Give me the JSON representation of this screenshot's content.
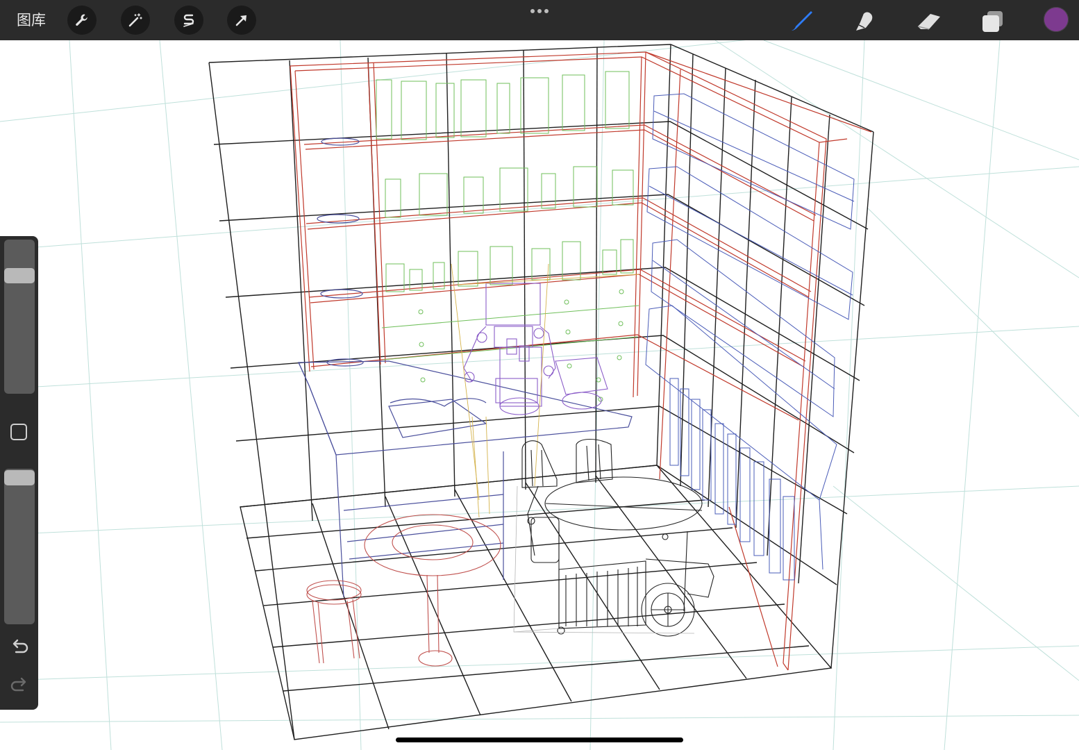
{
  "topbar": {
    "gallery_label": "图库",
    "tools_left": [
      {
        "name": "actions",
        "icon": "wrench-icon"
      },
      {
        "name": "adjustments",
        "icon": "magic-wand-icon"
      },
      {
        "name": "selection",
        "icon": "selection-s-icon"
      },
      {
        "name": "transform",
        "icon": "arrow-cursor-icon"
      }
    ],
    "more_icon": "ellipsis-icon",
    "tools_right": [
      {
        "name": "brush",
        "icon": "brush-icon",
        "active": true
      },
      {
        "name": "smudge",
        "icon": "smudge-finger-icon"
      },
      {
        "name": "eraser",
        "icon": "eraser-icon"
      },
      {
        "name": "layers",
        "icon": "layers-icon"
      }
    ],
    "current_color": "#7d3a8f",
    "active_tool_color": "#2e7cf6"
  },
  "sidebar": {
    "brush_size_level": 0.94,
    "opacity_level": 0.94,
    "modify_icon": "square-modify-icon",
    "undo_icon": "undo-icon",
    "redo_icon": "redo-icon"
  },
  "canvas": {
    "stroke_colors": {
      "guide": "#bfe0da",
      "grid": "#1e1e1e",
      "shelf_frame": "#c0392b",
      "books_front": "#6fbf5a",
      "books_side": "#4a5cb8",
      "furniture": "#4a4f9c",
      "robot": "#8a5cc8",
      "cart": "#222222",
      "table_stool": "#c0504d",
      "yellow_accent": "#d4b24a"
    }
  }
}
